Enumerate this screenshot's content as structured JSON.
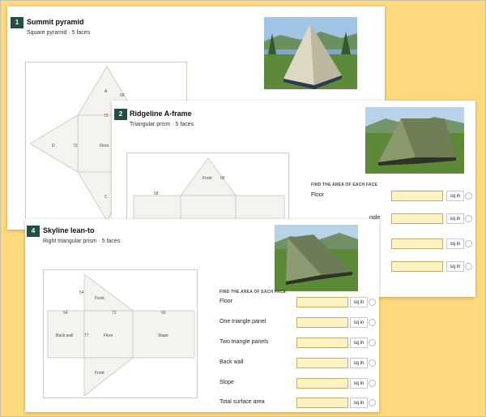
{
  "cards": {
    "c1": {
      "number": "1",
      "title": "Summit pyramid",
      "subtitle": "Square pyramid · 5 faces",
      "net": {
        "faces": [
          "A",
          "Floor",
          "D",
          "C"
        ],
        "dims": [
          "68",
          "72",
          "72"
        ]
      }
    },
    "c2": {
      "number": "2",
      "title": "Ridgeline A-frame",
      "subtitle": "Triangular prism · 5 faces",
      "net": {
        "faces": [
          "Front"
        ],
        "dims": [
          "68",
          "68"
        ]
      },
      "question_header": "FIND THE AREA OF EACH FACE",
      "rows": [
        {
          "label": "Floor",
          "value": "",
          "unit": "sq in"
        },
        {
          "label": "ngle",
          "value": "",
          "unit": "sq in"
        },
        {
          "label": "",
          "value": "",
          "unit": "sq in"
        },
        {
          "label": "",
          "value": "",
          "unit": "sq in"
        }
      ]
    },
    "c4": {
      "number": "4",
      "title": "Skyline lean-to",
      "subtitle": "Right triangular prism · 5 faces",
      "net": {
        "faces": [
          "Front",
          "Back wall",
          "Floor",
          "Slope",
          "Front"
        ],
        "dims": [
          "54",
          "54",
          "72",
          "90",
          "77"
        ]
      },
      "question_header": "FIND THE AREA OF EACH FACE",
      "rows": [
        {
          "label": "Floor",
          "value": "",
          "unit": "sq in"
        },
        {
          "label": "One triangle panel",
          "value": "",
          "unit": "sq in"
        },
        {
          "label": "Two triangle panels",
          "value": "",
          "unit": "sq in"
        },
        {
          "label": "Back wall",
          "value": "",
          "unit": "sq in"
        },
        {
          "label": "Slope",
          "value": "",
          "unit": "sq in"
        },
        {
          "label": "Total surface area",
          "value": "",
          "unit": "sq in"
        }
      ]
    }
  },
  "colors": {
    "badge": "#1f4f45",
    "input_fill": "#fff3c4",
    "background": "#ffd97d"
  }
}
